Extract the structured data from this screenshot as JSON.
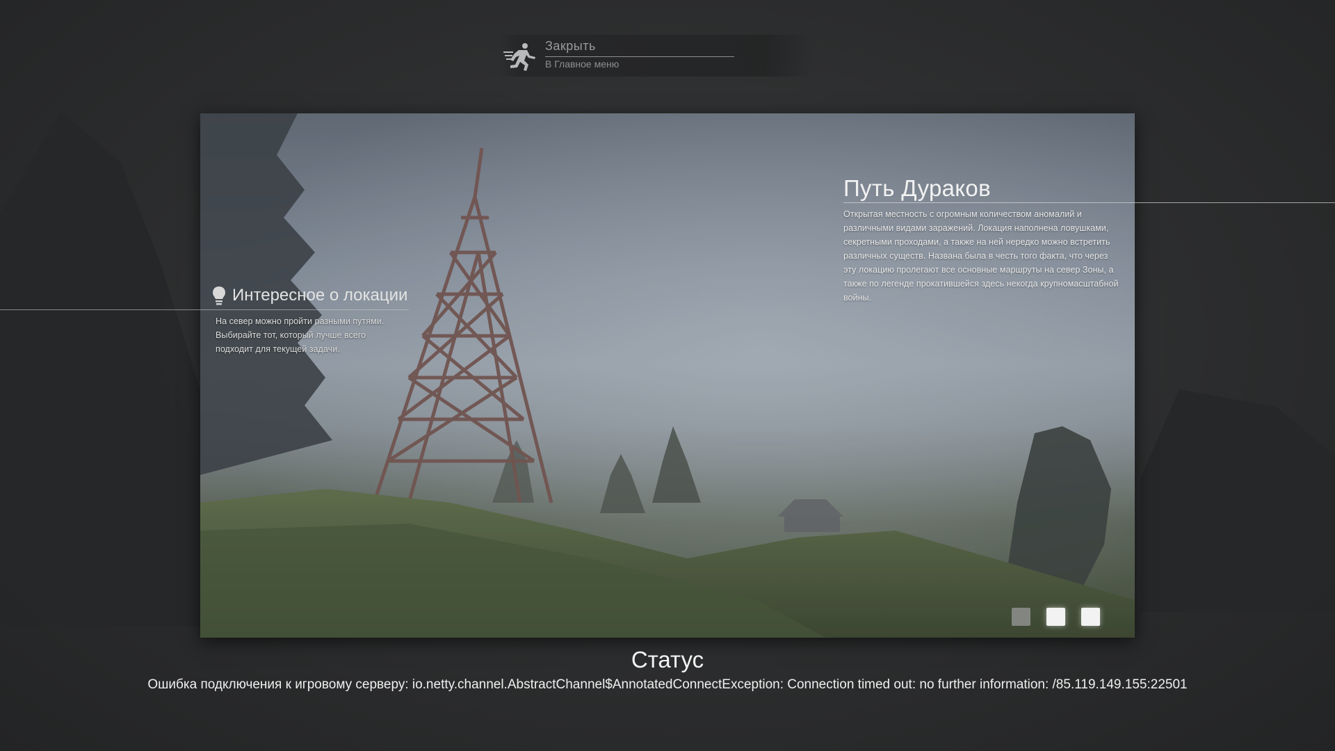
{
  "close_menu": {
    "title": "Закрыть",
    "subtitle": "В Главное меню",
    "icon": "running-man-icon"
  },
  "location": {
    "title": "Путь Дураков",
    "description": "Открытая местность с огромным количеством аномалий и различными видами заражений. Локация наполнена ловушками, секретными проходами, а также на ней нередко можно встретить различных существ. Названа была в честь того факта, что через эту локацию пролегают все основные маршруты на север Зоны, а также по легенде прокатившейся здесь некогда крупномасштабной войны."
  },
  "fact": {
    "title": "Интересное о локации",
    "text": "На север можно пройти разными путями. Выбирайте тот, который лучше всего подходит для текущей задачи.",
    "icon": "lightbulb-icon"
  },
  "slides": {
    "count": 3,
    "active": [
      false,
      true,
      true
    ]
  },
  "status": {
    "title": "Статус",
    "message": "Ошибка подключения к игровому серверу: io.netty.channel.AbstractChannel$AnnotatedConnectException: Connection timed out: no further information: /85.119.149.155:22501"
  }
}
